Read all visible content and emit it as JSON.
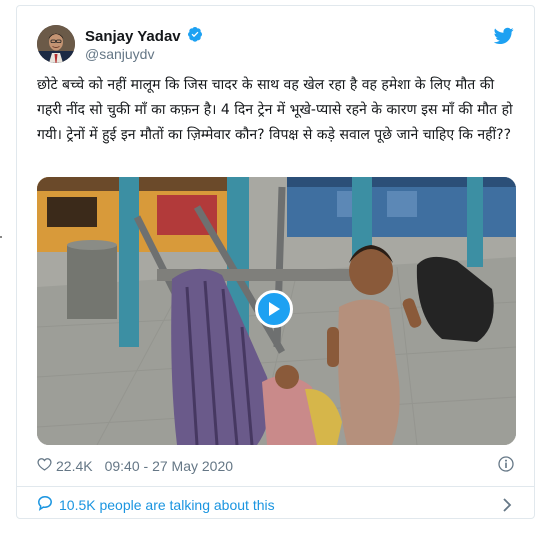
{
  "tweet": {
    "display_name": "Sanjay Yadav",
    "handle": "@sanjuydv",
    "verified": true,
    "text": "छोटे बच्चे को नहीं मालूम कि जिस चादर के साथ वह खेल रहा है वह हमेशा के लिए मौत की गहरी नींद सो चुकी माँ का कफ़न है। 4 दिन ट्रेन में भूखे-प्यासे रहने के कारण इस माँ की मौत हो गयी। ट्रेनों में हुई इन मौतों का ज़िम्मेवार कौन? विपक्ष से कड़े सवाल पूछे जाने चाहिए कि नहीं??",
    "media": {
      "kind": "video",
      "icon": "play-icon"
    },
    "likes": "22.4K",
    "timestamp": "09:40 - 27 May 2020",
    "conversation": "10.5K people are talking about this"
  },
  "icons": {
    "brand": "twitter-bird-icon",
    "verified": "verified-badge-icon",
    "like": "heart-icon",
    "info": "info-icon",
    "conversation": "speech-bubble-icon",
    "more": "chevron-right-icon"
  },
  "colors": {
    "accent": "#1da1f2",
    "link": "#1b95e0",
    "secondary_text": "#657786",
    "border": "#e1e8ed"
  }
}
